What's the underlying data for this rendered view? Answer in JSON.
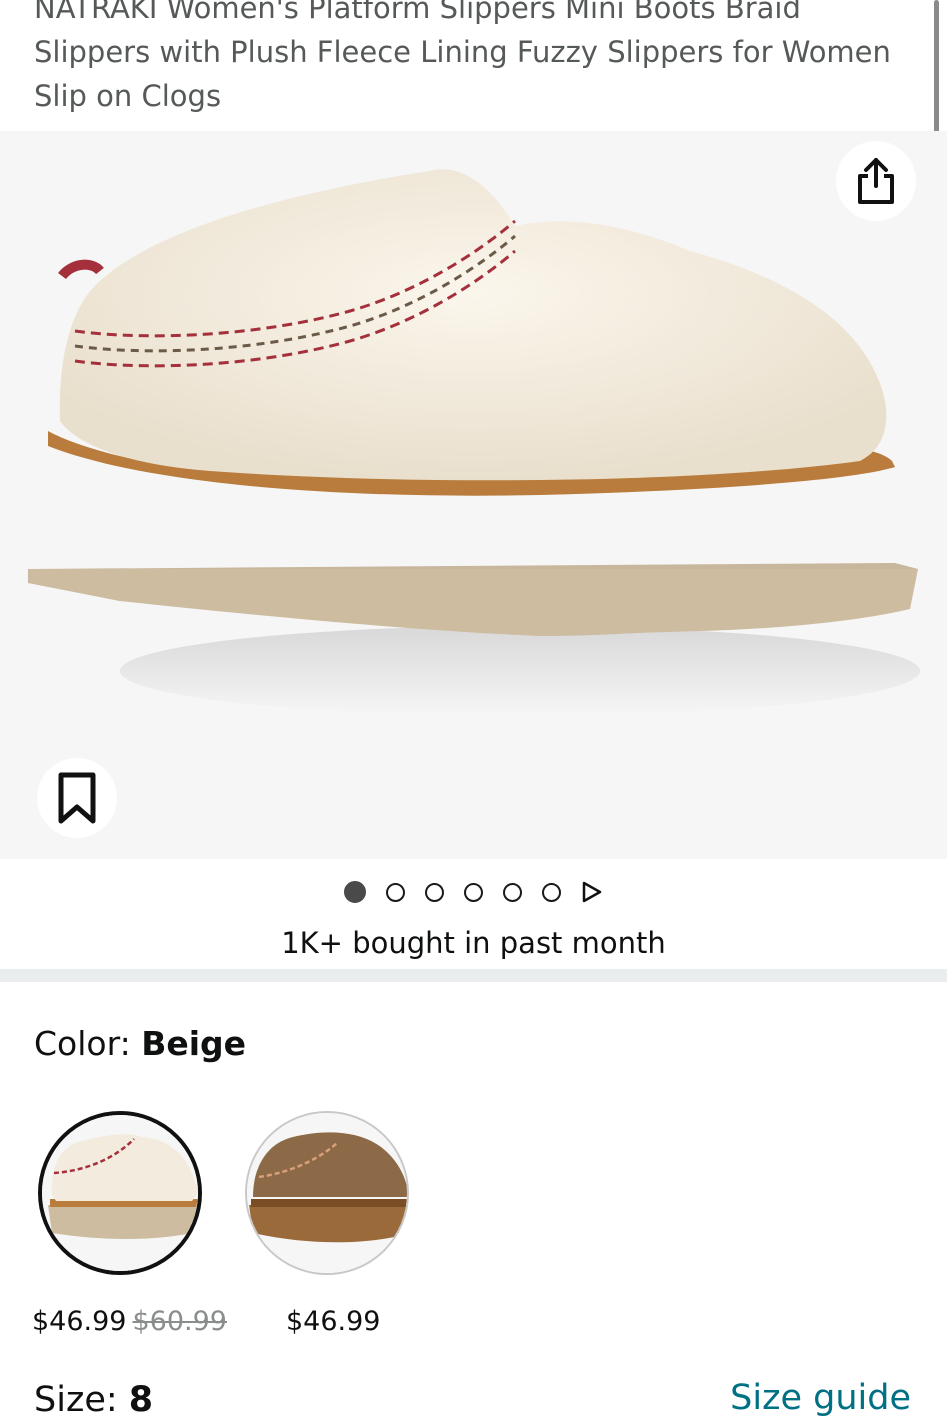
{
  "product": {
    "title": "NATRAKI Women's Platform Slippers Mini Boots Braid Slippers with Plush Fleece Lining Fuzzy Slippers for Women Slip on Clogs"
  },
  "gallery": {
    "share_icon": "share-icon",
    "save_icon": "bookmark-icon",
    "dot_count": 6,
    "active_dot": 1,
    "play_icon": "play-icon"
  },
  "social_proof": {
    "bought_text": "1K+ bought in past month"
  },
  "color": {
    "label": "Color: ",
    "selected": "Beige",
    "options": [
      {
        "name": "Beige",
        "price": "$46.99",
        "was_price": "$60.99"
      },
      {
        "name": "Brown",
        "price": "$46.99",
        "was_price": ""
      }
    ]
  },
  "size": {
    "label": "Size: ",
    "selected": "8",
    "guide_link": "Size guide"
  },
  "colors": {
    "link": "#007185",
    "text": "#0f1111",
    "muted": "#565959",
    "hero_bg": "#f6f6f6"
  }
}
